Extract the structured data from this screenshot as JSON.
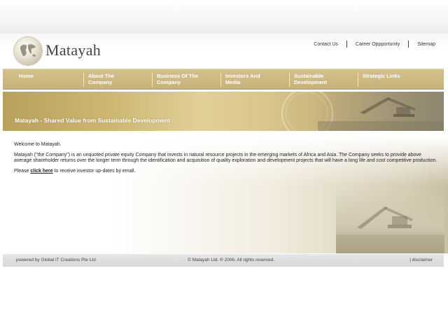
{
  "logo": {
    "text": "Matayah"
  },
  "top_links": [
    {
      "label": "Contact Us"
    },
    {
      "label": "Career Oppportunity"
    },
    {
      "label": "Sitemap"
    }
  ],
  "nav": [
    {
      "line1": "Home",
      "line2": ""
    },
    {
      "line1": "About The",
      "line2": "Company"
    },
    {
      "line1": "Business Of The",
      "line2": "Company"
    },
    {
      "line1": "Investors And",
      "line2": "Media"
    },
    {
      "line1": "Sustainable",
      "line2": "Development"
    },
    {
      "line1": "Strategic Links",
      "line2": ""
    }
  ],
  "banner": {
    "title": "Matayah - Shared Value from Sustainable Development"
  },
  "content": {
    "welcome": "Welcome to Matayah.",
    "paragraph": "Matayah (\"the Company\") is an unquoted private equity Company that invests in natural resource projects in the emerging markets of Africa and Asia. The Company seeks to provide above average shareholder returns over the longer term through the identification and acquisition of quality exploration and development projects that will have a long life and cost competitive production.",
    "please_prefix": "Please ",
    "link_text": "click here",
    "please_suffix": " to receive investor up-dates by email."
  },
  "footer": {
    "powered": "powered by Global IT Creations Pte Ltd",
    "copyright": "© Matayah Ltd. ® 2006. All rights reserved.",
    "disclaimer": "| disclaimer"
  },
  "colors": {
    "nav_gold": "#c9b47c",
    "banner_gold": "#cdb873",
    "footer_gray": "#dcdcdc"
  }
}
